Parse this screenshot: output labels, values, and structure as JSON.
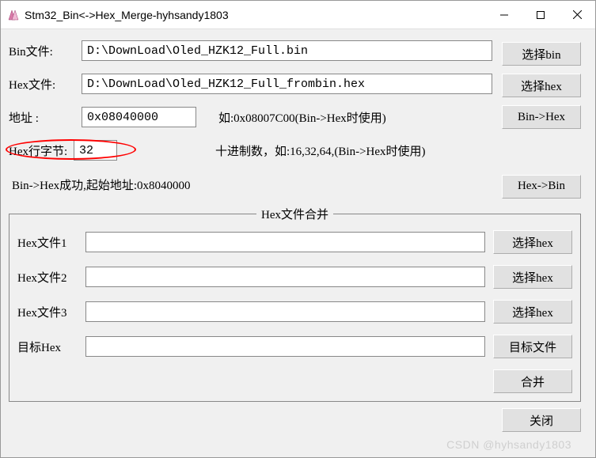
{
  "window": {
    "title": "Stm32_Bin<->Hex_Merge-hyhsandy1803"
  },
  "bin_file": {
    "label": "Bin文件:",
    "value": "D:\\DownLoad\\Oled_HZK12_Full.bin",
    "button": "选择bin"
  },
  "hex_file": {
    "label": "Hex文件:",
    "value": "D:\\DownLoad\\Oled_HZK12_Full_frombin.hex",
    "button": "选择hex"
  },
  "address": {
    "label": "地址  :",
    "value": "0x08040000",
    "hint": "如:0x08007C00(Bin->Hex时使用)",
    "button": "Bin->Hex"
  },
  "hex_row_bytes": {
    "label": "Hex行字节:",
    "value": "32",
    "hint": "十进制数，如:16,32,64,(Bin->Hex时使用)"
  },
  "status": "Bin->Hex成功,起始地址:0x8040000",
  "hex_to_bin_button": "Hex->Bin",
  "merge": {
    "legend": "Hex文件合并",
    "hex1": {
      "label": "Hex文件1",
      "value": "",
      "button": "选择hex"
    },
    "hex2": {
      "label": "Hex文件2",
      "value": "",
      "button": "选择hex"
    },
    "hex3": {
      "label": "Hex文件3",
      "value": "",
      "button": "选择hex"
    },
    "target": {
      "label": "目标Hex",
      "value": "",
      "button": "目标文件"
    },
    "merge_button": "合并"
  },
  "close_button": "关闭",
  "watermark": "CSDN @hyhsandy1803"
}
